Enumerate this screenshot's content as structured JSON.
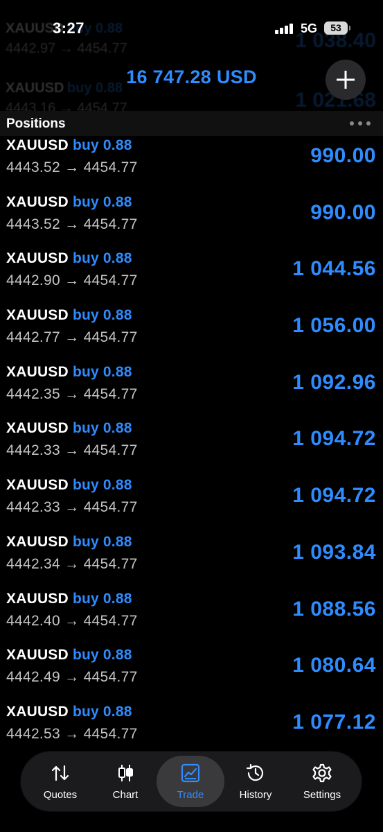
{
  "status": {
    "time": "3:27",
    "network": "5G",
    "battery": "53"
  },
  "ghost_rows": [
    {
      "symbol": "XAUUSD",
      "direction": "buy",
      "volume": "0.88",
      "prices": "4442.97 → 4454.77",
      "profit": "1 038.40"
    },
    {
      "symbol": "XAUUSD",
      "direction": "buy",
      "volume": "0.88",
      "prices": "4443.16 → 4454.77",
      "profit": "1 021.68"
    }
  ],
  "header": {
    "balance": "16 747.28 USD"
  },
  "section": {
    "title": "Positions"
  },
  "positions": [
    {
      "symbol": "XAUUSD",
      "direction": "buy",
      "volume": "0.88",
      "prices": "4443.52 → 4454.77",
      "profit": "990.00"
    },
    {
      "symbol": "XAUUSD",
      "direction": "buy",
      "volume": "0.88",
      "prices": "4443.52 → 4454.77",
      "profit": "990.00"
    },
    {
      "symbol": "XAUUSD",
      "direction": "buy",
      "volume": "0.88",
      "prices": "4442.90 → 4454.77",
      "profit": "1 044.56"
    },
    {
      "symbol": "XAUUSD",
      "direction": "buy",
      "volume": "0.88",
      "prices": "4442.77 → 4454.77",
      "profit": "1 056.00"
    },
    {
      "symbol": "XAUUSD",
      "direction": "buy",
      "volume": "0.88",
      "prices": "4442.35 → 4454.77",
      "profit": "1 092.96"
    },
    {
      "symbol": "XAUUSD",
      "direction": "buy",
      "volume": "0.88",
      "prices": "4442.33 → 4454.77",
      "profit": "1 094.72"
    },
    {
      "symbol": "XAUUSD",
      "direction": "buy",
      "volume": "0.88",
      "prices": "4442.33 → 4454.77",
      "profit": "1 094.72"
    },
    {
      "symbol": "XAUUSD",
      "direction": "buy",
      "volume": "0.88",
      "prices": "4442.34 → 4454.77",
      "profit": "1 093.84"
    },
    {
      "symbol": "XAUUSD",
      "direction": "buy",
      "volume": "0.88",
      "prices": "4442.40 → 4454.77",
      "profit": "1 088.56"
    },
    {
      "symbol": "XAUUSD",
      "direction": "buy",
      "volume": "0.88",
      "prices": "4442.49 → 4454.77",
      "profit": "1 080.64"
    },
    {
      "symbol": "XAUUSD",
      "direction": "buy",
      "volume": "0.88",
      "prices": "4442.53 → 4454.77",
      "profit": "1 077.12"
    }
  ],
  "tabs": [
    {
      "label": "Quotes",
      "icon": "quotes-arrows-icon"
    },
    {
      "label": "Chart",
      "icon": "candlestick-icon"
    },
    {
      "label": "Trade",
      "icon": "trade-chart-icon",
      "active": true
    },
    {
      "label": "History",
      "icon": "history-clock-icon"
    },
    {
      "label": "Settings",
      "icon": "gear-icon"
    }
  ],
  "colors": {
    "accent": "#2f8cff",
    "background": "#000000",
    "secondary_text": "#c4c4c6",
    "tab_bar": "#1c1c1e"
  }
}
